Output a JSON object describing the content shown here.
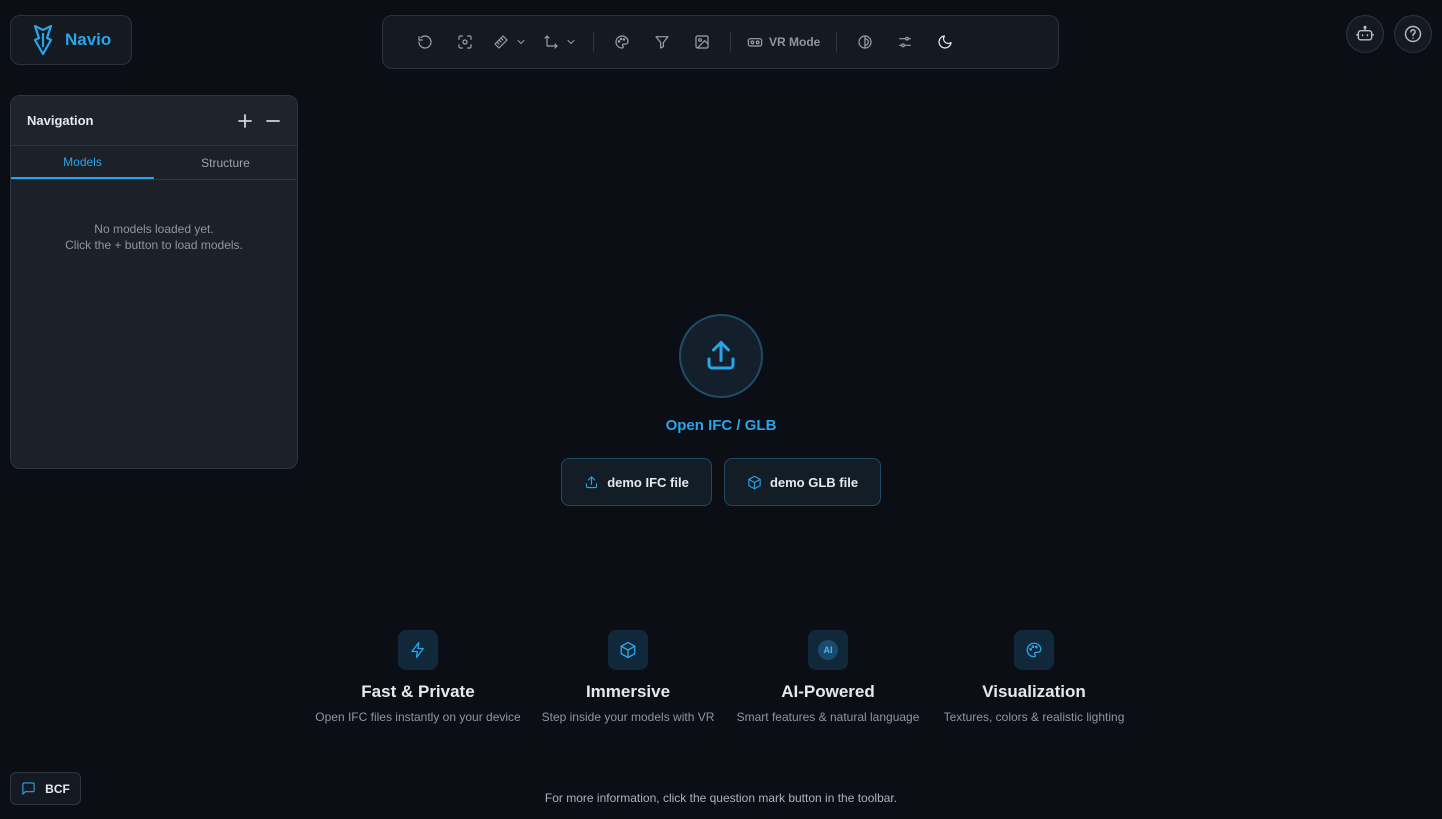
{
  "app": {
    "name": "Navio",
    "accent_color": "#2aa4e8",
    "background_color": "#0b0f15"
  },
  "toolbar": {
    "items": [
      {
        "icon": "reset-view-icon"
      },
      {
        "icon": "focus-icon"
      },
      {
        "icon": "measure-icon",
        "has_dropdown": true
      },
      {
        "icon": "section-axis-icon",
        "has_dropdown": true
      },
      {
        "icon": "palette-icon"
      },
      {
        "icon": "filter-icon"
      },
      {
        "icon": "image-icon"
      },
      {
        "icon": "vr-headset-icon"
      },
      {
        "icon": "contrast-icon"
      },
      {
        "icon": "settings-sliders-icon"
      },
      {
        "icon": "moon-icon"
      }
    ],
    "vr_label": "VR Mode"
  },
  "top_right": {
    "assistant_icon": "robot-icon",
    "help_icon": "help-icon"
  },
  "navigation": {
    "title": "Navigation",
    "tabs": [
      {
        "label": "Models",
        "active": true
      },
      {
        "label": "Structure",
        "active": false
      }
    ],
    "empty_line1": "No models loaded yet.",
    "empty_line2": "Click the + button to load models."
  },
  "upload": {
    "icon": "upload-icon",
    "open_label": "Open IFC / GLB",
    "demo_ifc_label": "demo IFC file",
    "demo_glb_label": "demo GLB file"
  },
  "features": [
    {
      "icon": "lightning-icon",
      "title": "Fast & Private",
      "desc": "Open IFC files instantly on your device"
    },
    {
      "icon": "cube-icon",
      "title": "Immersive",
      "desc": "Step inside your models with VR"
    },
    {
      "icon": "ai-icon",
      "icon_text": "AI",
      "title": "AI-Powered",
      "desc": "Smart features & natural language"
    },
    {
      "icon": "palette-icon",
      "title": "Visualization",
      "desc": "Textures, colors & realistic lighting"
    }
  ],
  "bcf": {
    "label": "BCF",
    "icon": "message-icon"
  },
  "footer": {
    "hint": "For more information, click the question mark button in the toolbar."
  }
}
